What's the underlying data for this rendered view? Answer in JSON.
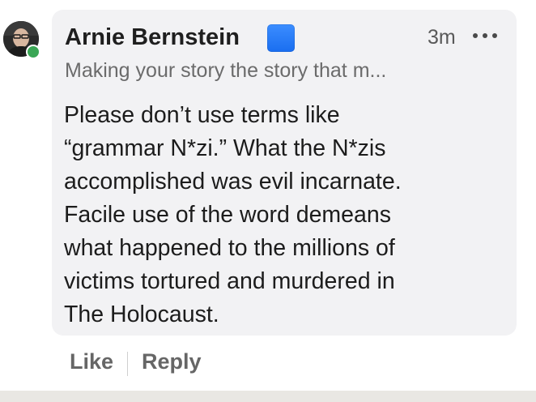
{
  "comment": {
    "author_name": "Arnie Bernstein",
    "author_badge_icon": "blue-square-emoji",
    "timestamp": "3m",
    "author_headline": "Making your story the story that m...",
    "body_lines": [
      "Please don’t use terms like",
      "“grammar N*zi.”  What the N*zis",
      "accomplished was evil incarnate.",
      "Facile use of the word demeans",
      "what happened to the millions of",
      "victims tortured and murdered in",
      "The Holocaust."
    ]
  },
  "actions": {
    "like_label": "Like",
    "reply_label": "Reply"
  },
  "colors": {
    "bubble_background": "#f2f2f4",
    "presence_online": "#3aa655",
    "badge_blue": "#1a6ef0"
  }
}
